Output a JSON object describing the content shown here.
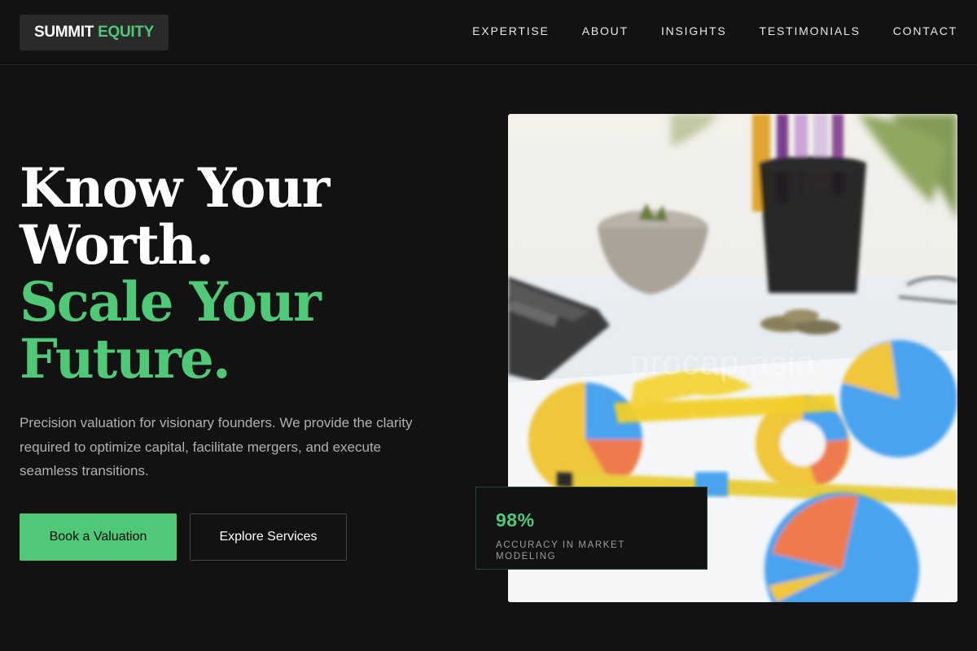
{
  "brand": {
    "part1": "SUMMIT",
    "part2": "EQUITY",
    "accent": "#4fc878"
  },
  "nav": {
    "items": [
      {
        "label": "EXPERTISE"
      },
      {
        "label": "ABOUT"
      },
      {
        "label": "INSIGHTS"
      },
      {
        "label": "TESTIMONIALS"
      },
      {
        "label": "CONTACT"
      }
    ]
  },
  "hero": {
    "line1": "Know Your",
    "line2": "Worth.",
    "line3": "Scale Your",
    "line4": "Future.",
    "description": "Precision valuation for visionary founders. We provide the clarity required to optimize capital, facilitate mergers, and execute seamless transitions.",
    "primary_cta": "Book a Valuation",
    "secondary_cta": "Explore Services",
    "image_watermark": "procap.asia"
  },
  "stat": {
    "value": "98%",
    "label": "ACCURACY IN MARKET MODELING"
  },
  "colors": {
    "background": "#121212",
    "accent": "#4fc878",
    "text_muted": "#b0b0b0"
  }
}
